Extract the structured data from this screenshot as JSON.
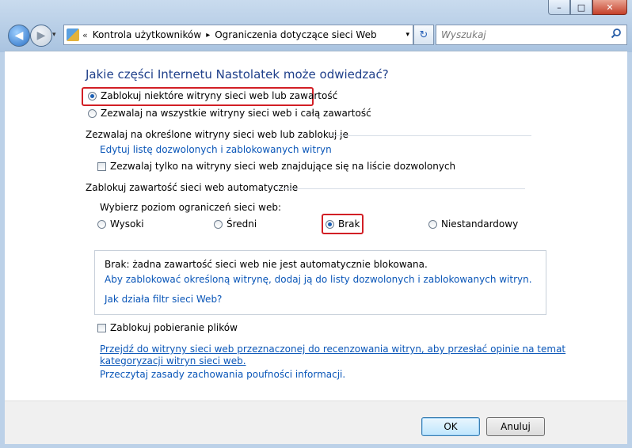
{
  "window": {
    "minimize": "–",
    "maximize": "□",
    "close": "✕"
  },
  "nav": {
    "back_glyph": "◀",
    "forward_glyph": "▶",
    "dropdown_glyph": "▾"
  },
  "address": {
    "chevron": "«",
    "crumb1": "Kontrola użytkowników",
    "separator": "▸",
    "crumb2": "Ograniczenia dotyczące sieci Web",
    "dropdown": "▾"
  },
  "refresh_glyph": "↻",
  "search": {
    "placeholder": "Wyszukaj",
    "icon": "⚲"
  },
  "heading": "Jakie części Internetu Nastolatek może odwiedzać?",
  "mode": {
    "option_block": "Zablokuj niektóre witryny sieci web lub zawartość",
    "option_allow": "Zezwalaj na wszystkie witryny sieci web i całą zawartość",
    "selected": "block"
  },
  "section_allowlist": {
    "title": "Zezwalaj na określone witryny sieci web lub zablokuj je",
    "link": "Edytuj listę dozwolonych i zablokowanych witryn",
    "checkbox": "Zezwalaj tylko na witryny sieci web znajdujące się na liście dozwolonych",
    "checked": false
  },
  "section_auto": {
    "title": "Zablokuj zawartość sieci web automatycznie",
    "level_label": "Wybierz poziom ograniczeń sieci web:",
    "levels": [
      "Wysoki",
      "Średni",
      "Brak",
      "Niestandardowy"
    ],
    "selected_level": "Brak"
  },
  "info": {
    "text": "Brak: żadna zawartość sieci web nie jest automatycznie blokowana.",
    "link1": "Aby zablokować określoną witrynę, dodaj ją do listy dozwolonych i zablokowanych witryn.",
    "link2": "Jak działa filtr sieci Web?"
  },
  "downloads": {
    "checkbox": "Zablokuj pobieranie plików",
    "checked": false
  },
  "bottom_links": {
    "review_line1": "Przejdź do witryny sieci web przeznaczonej do recenzowania witryn, aby przesłać opinie na temat",
    "review_line2": "kategoryzacji witryn sieci web.",
    "privacy": "Przeczytaj zasady zachowania poufności informacji."
  },
  "buttons": {
    "ok": "OK",
    "cancel": "Anuluj"
  },
  "colors": {
    "link": "#0a56b8",
    "heading": "#1e3f8a",
    "highlight_box": "#d21f25"
  }
}
